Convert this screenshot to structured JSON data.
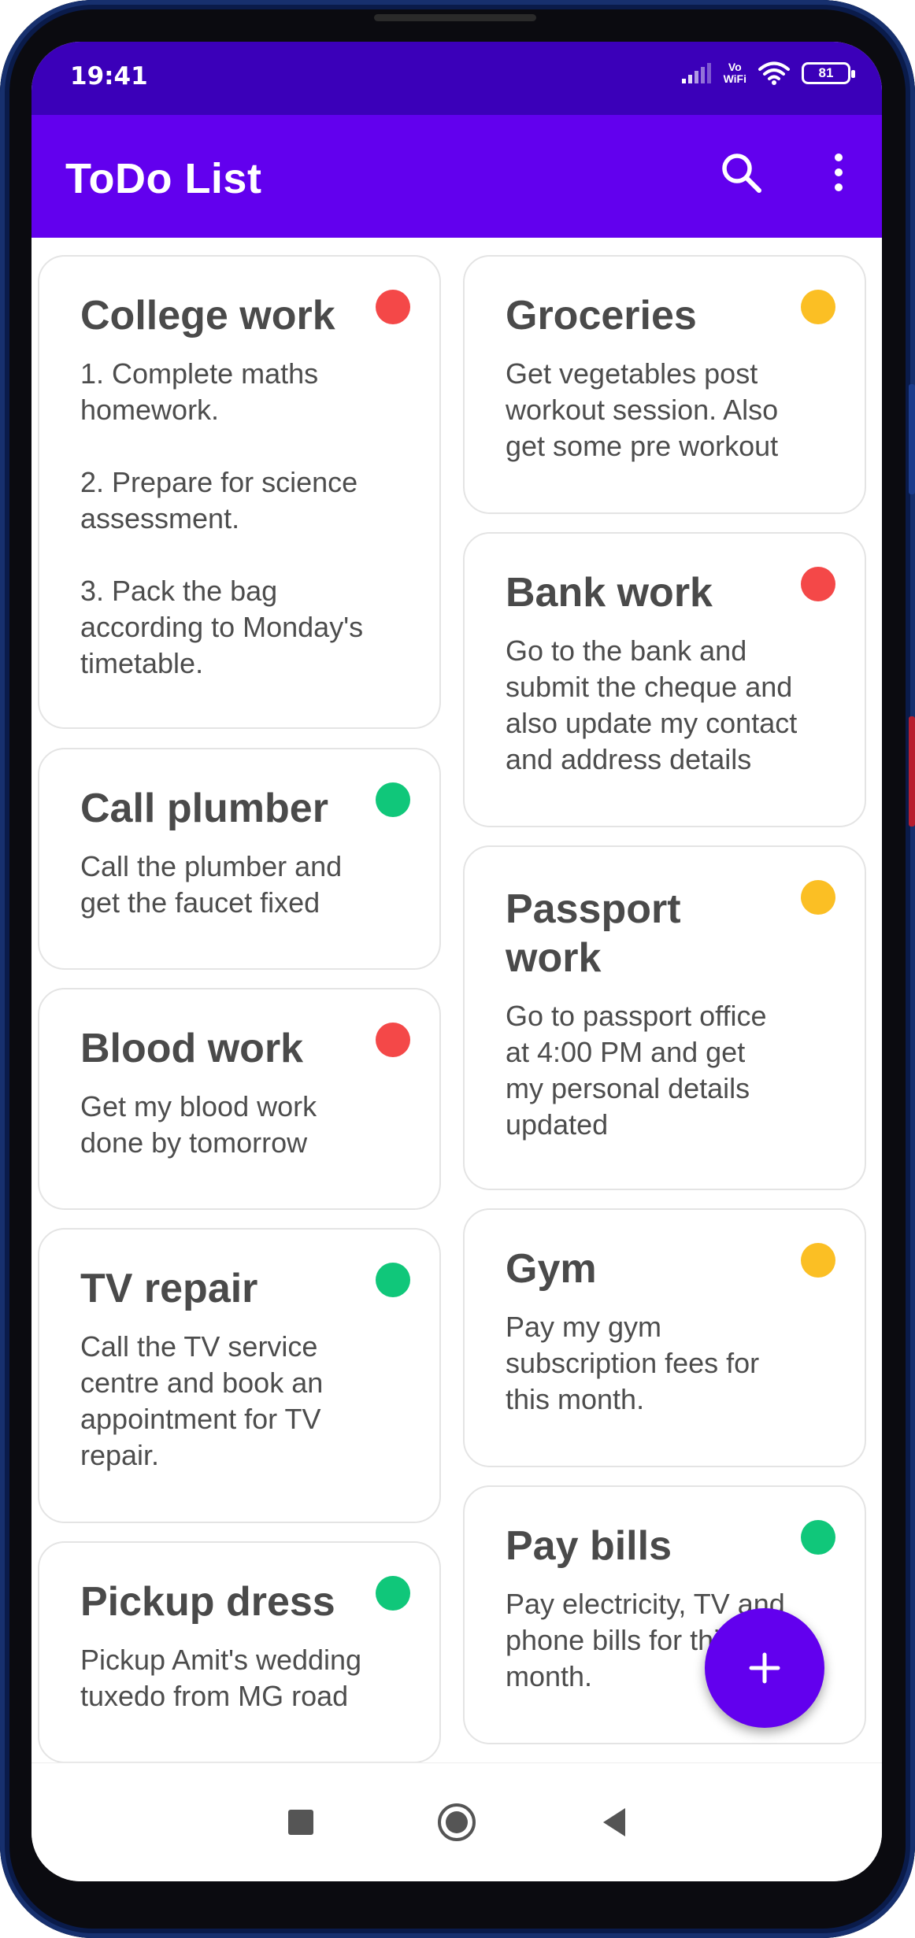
{
  "status_bar": {
    "time": "19:41",
    "volte_top": "Vo",
    "volte_bottom": "WiFi",
    "battery": "81"
  },
  "app_bar": {
    "title": "ToDo List",
    "search_icon": "search-icon",
    "more_icon": "more-vert-icon"
  },
  "colors": {
    "primary": "#6200ee",
    "status_bar": "#3b00b9",
    "high": "#f44848",
    "medium": "#fbbf24",
    "low": "#10c77a"
  },
  "notes": [
    {
      "title": "College work",
      "body": "1. Complete maths\nhomework.\n\n2. Prepare for science\nassessment.\n\n3. Pack the bag\naccording to Monday's\ntimetable.",
      "priority_color": "#f44848"
    },
    {
      "title": "Groceries",
      "body": "Get vegetables post\nworkout session. Also\nget some pre workout",
      "priority_color": "#fbbf24"
    },
    {
      "title": "Bank work",
      "body": "Go to the bank and\nsubmit the cheque and\nalso update my contact\nand address details",
      "priority_color": "#f44848"
    },
    {
      "title": "Call plumber",
      "body": "Call the plumber and\nget the faucet fixed",
      "priority_color": "#10c77a"
    },
    {
      "title": "Passport\nwork",
      "body": "Go to passport office\nat 4:00 PM and get\nmy personal details\nupdated",
      "priority_color": "#fbbf24"
    },
    {
      "title": "Blood work",
      "body": "Get my blood work\ndone by tomorrow",
      "priority_color": "#f44848"
    },
    {
      "title": "Gym",
      "body": "Pay my gym\nsubscription fees for\nthis month.",
      "priority_color": "#fbbf24"
    },
    {
      "title": "TV repair",
      "body": "Call the TV service\ncentre and book an\nappointment for TV\nrepair.",
      "priority_color": "#10c77a"
    },
    {
      "title": "Pay bills",
      "body": "Pay electricity, TV and\nphone bills for this\nmonth.",
      "priority_color": "#10c77a"
    },
    {
      "title": "Pickup dress",
      "body": "Pickup Amit's wedding\ntuxedo from MG road",
      "priority_color": "#10c77a"
    }
  ],
  "fab": {
    "icon": "plus-icon"
  },
  "nav_bar": {
    "icons": [
      "recents-square-icon",
      "home-circle-icon",
      "back-triangle-icon"
    ]
  }
}
